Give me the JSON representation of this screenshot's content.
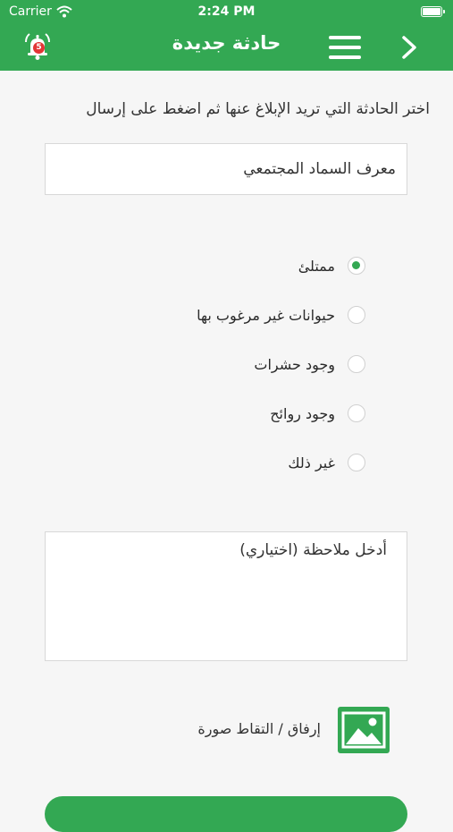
{
  "status_bar": {
    "carrier": "Carrier",
    "time": "2:24 PM"
  },
  "header": {
    "title": "حادثة جديدة",
    "notification_count": "5",
    "icons": [
      "bell-icon",
      "menu-icon",
      "chevron-right-icon"
    ]
  },
  "form": {
    "instruction": "اختر الحادثة التي تريد الإبلاغ عنها ثم اضغط على إرسال",
    "selected_location": "معرف السماد المجتمعي",
    "options": [
      {
        "label": "ممتلئ",
        "checked": true
      },
      {
        "label": "حيوانات غير مرغوب بها",
        "checked": false
      },
      {
        "label": "وجود حشرات",
        "checked": false
      },
      {
        "label": "وجود روائح",
        "checked": false
      },
      {
        "label": "غير ذلك",
        "checked": false
      }
    ],
    "note_placeholder": "أدخل ملاحظة (اختياري)",
    "attach_label": "إرفاق / التقاط صورة"
  },
  "colors": {
    "primary": "#33a853",
    "badge": "#e23636",
    "background": "#f6f6f6"
  }
}
